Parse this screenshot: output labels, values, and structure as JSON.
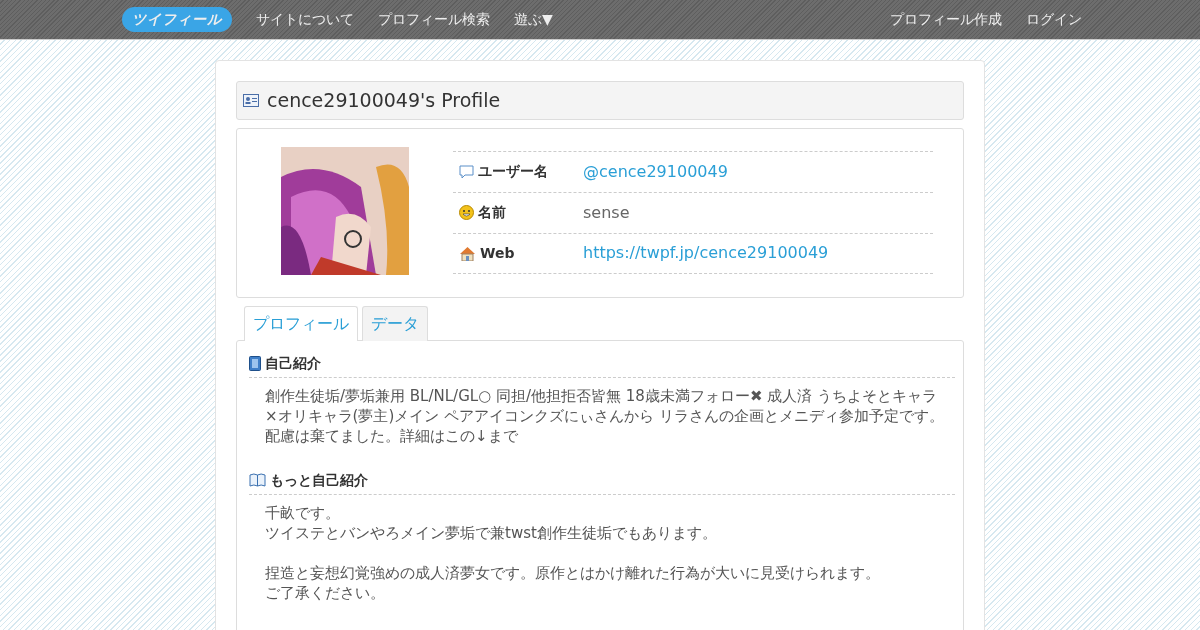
{
  "navbar": {
    "logo": "ツイフィール",
    "left_links": [
      "サイトについて",
      "プロフィール検索",
      "遊ぶ▼"
    ],
    "right_links": [
      "プロフィール作成",
      "ログイン"
    ]
  },
  "profile": {
    "title": "cence29100049's Profile",
    "fields": [
      {
        "kind": "speech",
        "label": "ユーザー名",
        "value": "@cence29100049",
        "link": true
      },
      {
        "kind": "smile",
        "label": "名前",
        "value": "sense",
        "link": false
      },
      {
        "kind": "home",
        "label": "Web",
        "value": "https://twpf.jp/cence29100049",
        "link": true
      }
    ]
  },
  "tabs": [
    {
      "label": "プロフィール",
      "selected": true
    },
    {
      "label": "データ",
      "selected": false
    }
  ],
  "sections": [
    {
      "kind": "note",
      "heading": "自己紹介",
      "paragraphs": [
        [
          "創作生徒垢/夢垢兼用 BL/NL/GL○ 同担/他担拒否皆無 18歳未満フォロー✖ 成人済 うちよそとキャラ×オリキャラ(夢主)メイン ペアアイコンクズにぃさんから リラさんの企画とメニディ参加予定です。配慮は棄てました。詳細はこの↓まで"
        ]
      ]
    },
    {
      "kind": "book",
      "heading": "もっと自己紹介",
      "paragraphs": [
        [
          "千畝です。",
          "ツイステとバンやろメイン夢垢で兼twst創作生徒垢でもあります。"
        ],
        [
          "捏造と妄想幻覚強めの成人済夢女です。原作とはかけ離れた行為が大いに見受けられます。",
          "ご了承ください。"
        ]
      ]
    }
  ]
}
